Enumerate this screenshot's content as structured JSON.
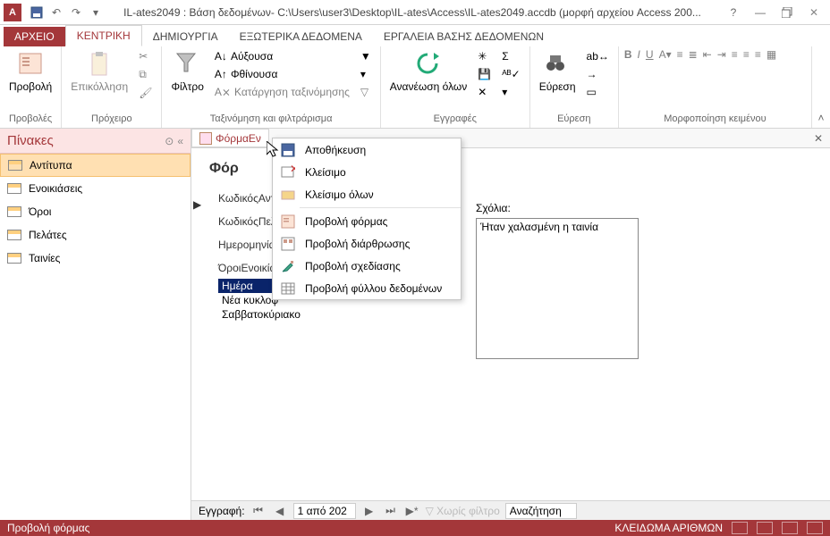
{
  "titlebar": {
    "app_initial": "A",
    "title": "IL-ates2049 : Βάση δεδομένων- C:\\Users\\user3\\Desktop\\IL-ates\\Access\\IL-ates2049.accdb (μορφή αρχείου Access 200...",
    "help": "?"
  },
  "ribbon_tabs": {
    "file": "ΑΡΧΕΙΟ",
    "home": "ΚΕΝΤΡΙΚΗ",
    "create": "ΔΗΜΙΟΥΡΓΙΑ",
    "external": "ΕΞΩΤΕΡΙΚΑ ΔΕΔΟΜΕΝΑ",
    "dbtools": "ΕΡΓΑΛΕΙΑ ΒΑΣΗΣ ΔΕΔΟΜΕΝΩΝ"
  },
  "ribbon": {
    "views": {
      "btn": "Προβολή",
      "label": "Προβολές"
    },
    "clipboard": {
      "paste": "Επικόλληση",
      "label": "Πρόχειρο"
    },
    "sortfilter": {
      "filter": "Φίλτρο",
      "asc": "Αύξουσα",
      "desc": "Φθίνουσα",
      "clear": "Κατάργηση ταξινόμησης",
      "label": "Ταξινόμηση και φιλτράρισμα"
    },
    "records": {
      "refresh": "Ανανέωση όλων",
      "label": "Εγγραφές"
    },
    "find": {
      "find": "Εύρεση",
      "label": "Εύρεση"
    },
    "format": {
      "label": "Μορφοποίηση κειμένου"
    }
  },
  "nav": {
    "title": "Πίνακες",
    "items": [
      "Αντίτυπα",
      "Ενοικιάσεις",
      "Όροι",
      "Πελάτες",
      "Ταινίες"
    ]
  },
  "doc": {
    "tab_label": "ΦόρμαΕν",
    "form_title": "Φόρ",
    "fields": {
      "f0": "ΚωδικόςΑντι",
      "f1": "ΚωδικόςΠελ",
      "f2": "Ημερομηνία",
      "f3": "ΌροιΕνοικία"
    },
    "options": {
      "o0": "Ημέρα",
      "o1": "Νέα κυκλοφ",
      "o2": "Σαββατοκύριακο"
    },
    "comments_label": "Σχόλια:",
    "comments_value": "Ήταν χαλασμένη η ταινία"
  },
  "recordnav": {
    "label": "Εγγραφή:",
    "position": "1 από 202",
    "nofilter": "Χωρίς φίλτρο",
    "search": "Αναζήτηση"
  },
  "context_menu": {
    "save": "Αποθήκευση",
    "close": "Κλείσιμο",
    "close_all": "Κλείσιμο όλων",
    "form_view": "Προβολή φόρμας",
    "layout_view": "Προβολή διάρθρωσης",
    "design_view": "Προβολή σχεδίασης",
    "datasheet_view": "Προβολή φύλλου δεδομένων"
  },
  "statusbar": {
    "left": "Προβολή φόρμας",
    "right": "ΚΛΕΙΔΩΜΑ ΑΡΙΘΜΩΝ"
  }
}
